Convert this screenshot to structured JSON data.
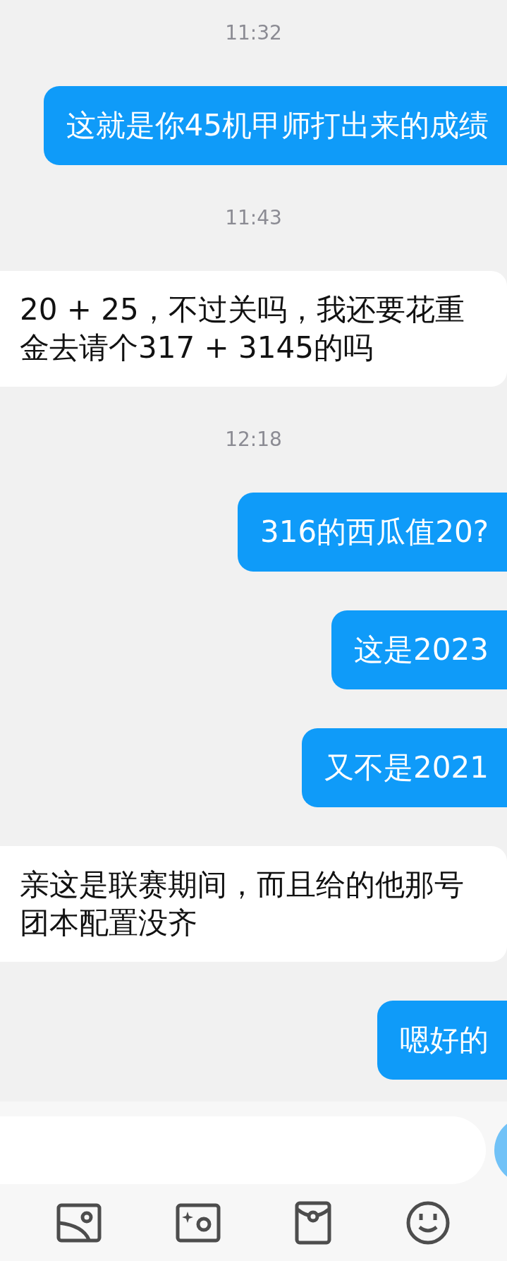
{
  "messages": [
    {
      "kind": "time",
      "text": "11:32"
    },
    {
      "kind": "sent",
      "text": "这就是你45机甲师打出来的成绩"
    },
    {
      "kind": "time",
      "text": "11:43"
    },
    {
      "kind": "received",
      "text": "20 + 25，不过关吗，我还要花重金去请个317 + 3145的吗"
    },
    {
      "kind": "time",
      "text": "12:18"
    },
    {
      "kind": "sent",
      "text": "316的西瓜值20?"
    },
    {
      "kind": "sent",
      "text": "这是2023"
    },
    {
      "kind": "sent",
      "text": "又不是2021"
    },
    {
      "kind": "received",
      "text": "亲这是联赛期间，而且给的他那号团本配置没齐"
    },
    {
      "kind": "sent",
      "text": "嗯好的"
    }
  ]
}
